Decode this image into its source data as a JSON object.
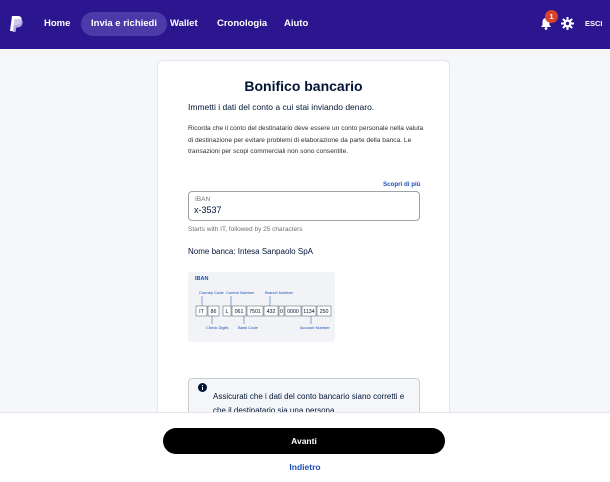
{
  "nav": {
    "items": [
      {
        "label": "Home"
      },
      {
        "label": "Invia e richiedi"
      },
      {
        "label": "Wallet"
      },
      {
        "label": "Cronologia"
      },
      {
        "label": "Aiuto"
      }
    ],
    "notification_count": "1",
    "logout_label": "ESCI"
  },
  "form": {
    "title": "Bonifico bancario",
    "intro": "Immetti i dati del conto a cui stai inviando denaro.",
    "note": "Ricorda che il conto del destinatario deve essere un conto personale nella valuta di destinazione per evitare problemi di elaborazione da parte della banca. Le transazioni per scopi commerciali non sono consentite.",
    "learn_more": "Scopri di più",
    "iban_label": "IBAN",
    "iban_value": "x-3537",
    "helper": "Starts with IT, followed by 25 characters",
    "bank_name": "Nome banca: Intesa Sanpaolo SpA"
  },
  "iban_diagram": {
    "title": "IBAN",
    "top_labels": [
      "Country Code",
      "Control Number",
      "Branch Number"
    ],
    "bottom_labels": [
      "Check Digits",
      "Bank Code",
      "Account Number"
    ],
    "segments": [
      "IT",
      "86",
      "L",
      "061",
      "7501",
      "432",
      "0",
      "0000",
      "1134",
      "250"
    ]
  },
  "info": {
    "text": "Assicurati che i dati del conto bancario siano corretti e che il destinatario sia una persona"
  },
  "footer": {
    "next_label": "Avanti",
    "back_label": "Indietro"
  }
}
